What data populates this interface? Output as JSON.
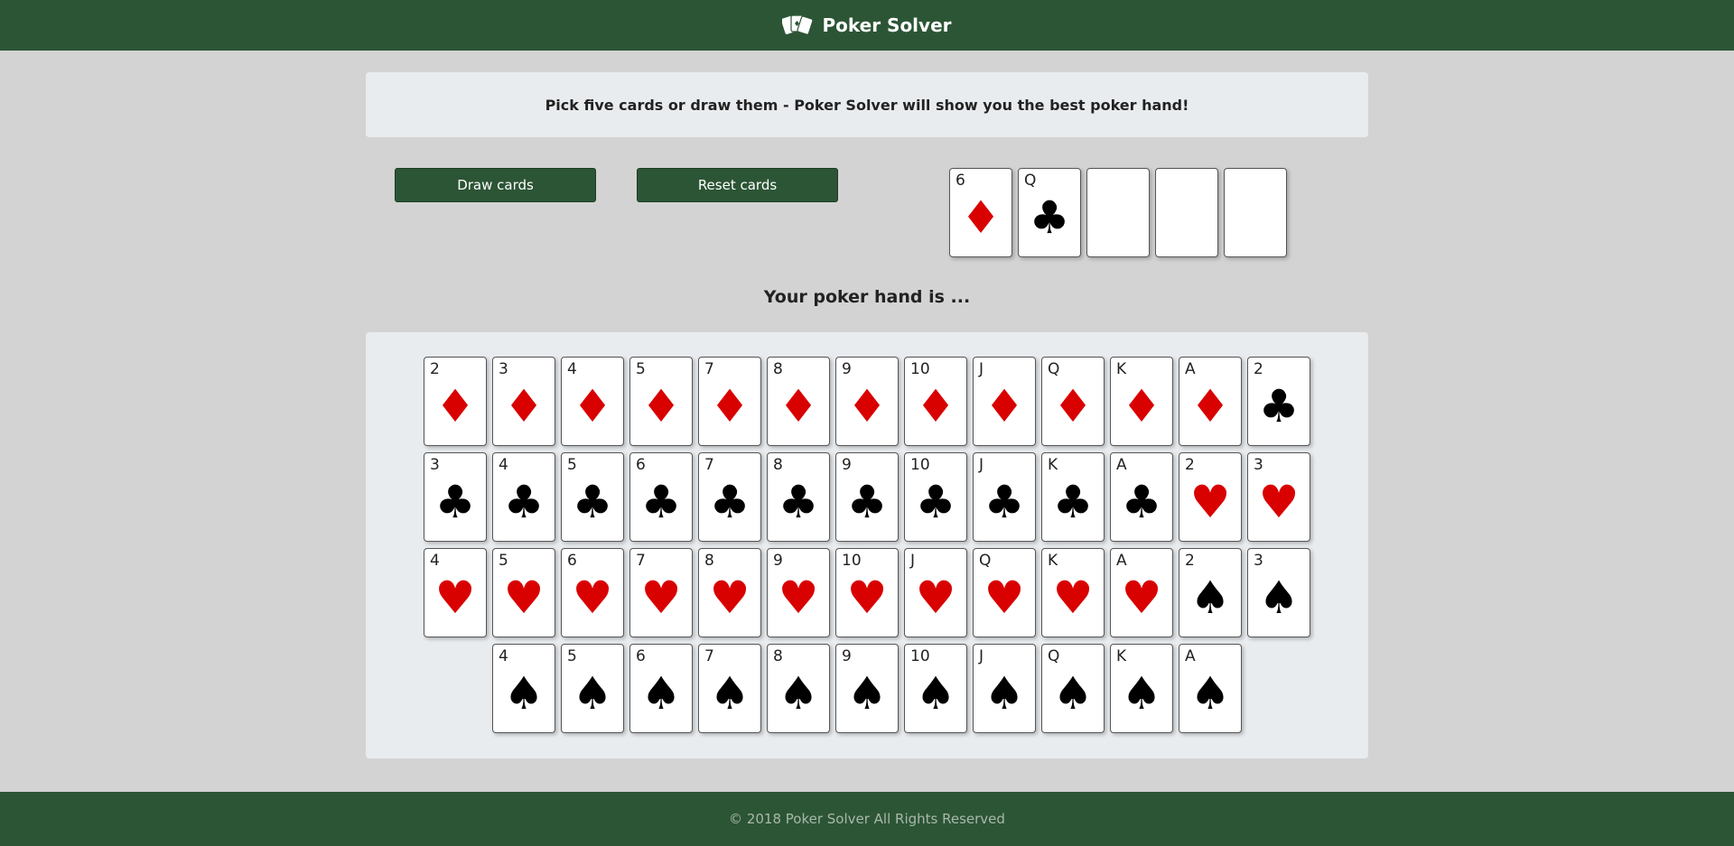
{
  "header": {
    "title": "Poker Solver",
    "logo_icon": "playing-cards-icon"
  },
  "intro": {
    "text": "Pick five cards or draw them - Poker Solver will show you the best poker hand!"
  },
  "buttons": {
    "draw": "Draw cards",
    "reset": "Reset cards"
  },
  "colors": {
    "primary": "#2c5535",
    "background": "#d3d3d3",
    "panel": "#e9ecef",
    "red_suit": "#d90000"
  },
  "selected_hand": [
    {
      "rank": "6",
      "suit": "diamonds"
    },
    {
      "rank": "Q",
      "suit": "clubs"
    },
    null,
    null,
    null
  ],
  "hand_result": {
    "text": "Your poker hand is ..."
  },
  "deck_rows": [
    [
      {
        "rank": "2",
        "suit": "diamonds"
      },
      {
        "rank": "3",
        "suit": "diamonds"
      },
      {
        "rank": "4",
        "suit": "diamonds"
      },
      {
        "rank": "5",
        "suit": "diamonds"
      },
      {
        "rank": "7",
        "suit": "diamonds"
      },
      {
        "rank": "8",
        "suit": "diamonds"
      },
      {
        "rank": "9",
        "suit": "diamonds"
      },
      {
        "rank": "10",
        "suit": "diamonds"
      },
      {
        "rank": "J",
        "suit": "diamonds"
      },
      {
        "rank": "Q",
        "suit": "diamonds"
      },
      {
        "rank": "K",
        "suit": "diamonds"
      },
      {
        "rank": "A",
        "suit": "diamonds"
      },
      {
        "rank": "2",
        "suit": "clubs"
      }
    ],
    [
      {
        "rank": "3",
        "suit": "clubs"
      },
      {
        "rank": "4",
        "suit": "clubs"
      },
      {
        "rank": "5",
        "suit": "clubs"
      },
      {
        "rank": "6",
        "suit": "clubs"
      },
      {
        "rank": "7",
        "suit": "clubs"
      },
      {
        "rank": "8",
        "suit": "clubs"
      },
      {
        "rank": "9",
        "suit": "clubs"
      },
      {
        "rank": "10",
        "suit": "clubs"
      },
      {
        "rank": "J",
        "suit": "clubs"
      },
      {
        "rank": "K",
        "suit": "clubs"
      },
      {
        "rank": "A",
        "suit": "clubs"
      },
      {
        "rank": "2",
        "suit": "hearts"
      },
      {
        "rank": "3",
        "suit": "hearts"
      }
    ],
    [
      {
        "rank": "4",
        "suit": "hearts"
      },
      {
        "rank": "5",
        "suit": "hearts"
      },
      {
        "rank": "6",
        "suit": "hearts"
      },
      {
        "rank": "7",
        "suit": "hearts"
      },
      {
        "rank": "8",
        "suit": "hearts"
      },
      {
        "rank": "9",
        "suit": "hearts"
      },
      {
        "rank": "10",
        "suit": "hearts"
      },
      {
        "rank": "J",
        "suit": "hearts"
      },
      {
        "rank": "Q",
        "suit": "hearts"
      },
      {
        "rank": "K",
        "suit": "hearts"
      },
      {
        "rank": "A",
        "suit": "hearts"
      },
      {
        "rank": "2",
        "suit": "spades"
      },
      {
        "rank": "3",
        "suit": "spades"
      }
    ],
    [
      {
        "rank": "4",
        "suit": "spades"
      },
      {
        "rank": "5",
        "suit": "spades"
      },
      {
        "rank": "6",
        "suit": "spades"
      },
      {
        "rank": "7",
        "suit": "spades"
      },
      {
        "rank": "8",
        "suit": "spades"
      },
      {
        "rank": "9",
        "suit": "spades"
      },
      {
        "rank": "10",
        "suit": "spades"
      },
      {
        "rank": "J",
        "suit": "spades"
      },
      {
        "rank": "Q",
        "suit": "spades"
      },
      {
        "rank": "K",
        "suit": "spades"
      },
      {
        "rank": "A",
        "suit": "spades"
      }
    ]
  ],
  "footer": {
    "text": "© 2018 Poker Solver All Rights Reserved"
  }
}
